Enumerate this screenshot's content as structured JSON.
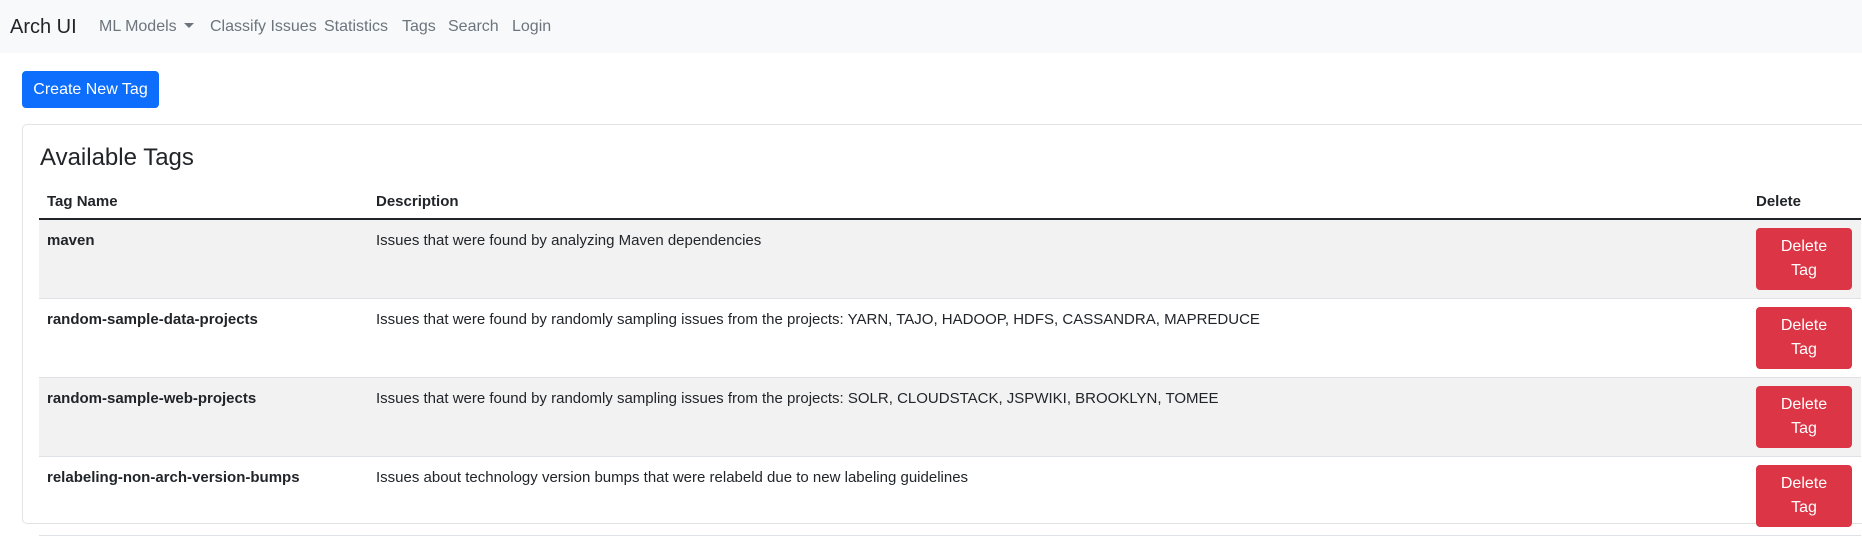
{
  "navbar": {
    "brand": "Arch UI",
    "items": [
      {
        "label": "ML Models",
        "dropdown": true
      },
      {
        "label": "Classify Issues"
      },
      {
        "label": "Statistics"
      },
      {
        "label": "Tags"
      },
      {
        "label": "Search"
      },
      {
        "label": "Login"
      }
    ]
  },
  "actions": {
    "create_label": "Create New Tag"
  },
  "card": {
    "title": "Available Tags",
    "columns": [
      "Tag Name",
      "Description",
      "Delete"
    ],
    "rows": [
      {
        "name": "maven",
        "description": "Issues that were found by analyzing Maven dependencies",
        "delete_label": "Delete Tag"
      },
      {
        "name": "random-sample-data-projects",
        "description": "Issues that were found by randomly sampling issues from the projects: YARN, TAJO, HADOOP, HDFS, CASSANDRA, MAPREDUCE",
        "delete_label": "Delete Tag"
      },
      {
        "name": "random-sample-web-projects",
        "description": "Issues that were found by randomly sampling issues from the projects: SOLR, CLOUDSTACK, JSPWIKI, BROOKLYN, TOMEE",
        "delete_label": "Delete Tag"
      },
      {
        "name": "relabeling-non-arch-version-bumps",
        "description": "Issues about technology version bumps that were relabeld due to new labeling guidelines",
        "delete_label": "Delete Tag"
      }
    ]
  },
  "colors": {
    "primary": "#0d6efd",
    "danger": "#dc3545",
    "navbar_bg": "#f8f9fa",
    "nav_text": "#6c757d"
  }
}
